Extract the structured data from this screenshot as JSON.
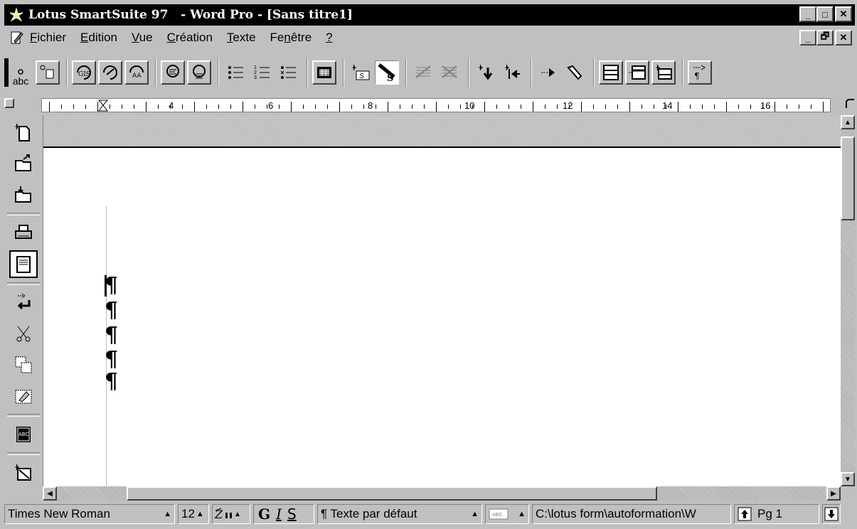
{
  "window": {
    "title": "Lotus SmartSuite 97   - Word Pro - [Sans titre1]",
    "minimize_label": "_",
    "maximize_label": "□",
    "restore_label": "🗗",
    "close_label": "✕"
  },
  "menu": {
    "items": [
      {
        "label": "Fichier",
        "accel": "F"
      },
      {
        "label": "Edition",
        "accel": "E"
      },
      {
        "label": "Vue",
        "accel": "V"
      },
      {
        "label": "Création",
        "accel": "C"
      },
      {
        "label": "Texte",
        "accel": "T"
      },
      {
        "label": "Fenêtre",
        "accel": "n"
      },
      {
        "label": "?",
        "accel": "?"
      }
    ]
  },
  "toolbar": {
    "abc_label": "abc",
    "icons": [
      "abc-frame-icon",
      "frame-icon",
      "gis-style-icon",
      "fast-format-icon",
      "aa-size-icon",
      "align-left-icon",
      "align-center-icon",
      "bullets-icon",
      "numbered-list-icon",
      "checklist-icon",
      "table-grid-icon",
      "spell-insert-icon",
      "spell-check-icon",
      "strike-grid-icon",
      "strike-grid2-icon",
      "insert-down-icon",
      "goto-begin-icon",
      "arrow-right-icon",
      "flashlight-icon",
      "page-layout-icon",
      "page-insert-icon",
      "page-add-icon",
      "show-marks-icon"
    ]
  },
  "ruler": {
    "numbers": [
      "4",
      "6",
      "8",
      "10",
      "12",
      "14",
      "16"
    ]
  },
  "document": {
    "pilcrow": "¶",
    "paragraph_count": 5
  },
  "status": {
    "font": "Times New Roman",
    "size": "12",
    "bold": "G",
    "italic": "I",
    "underline": "S",
    "style": "¶ Texte par défaut",
    "path": "C:\\lotus form\\autoformation\\W",
    "page": "Pg 1"
  }
}
